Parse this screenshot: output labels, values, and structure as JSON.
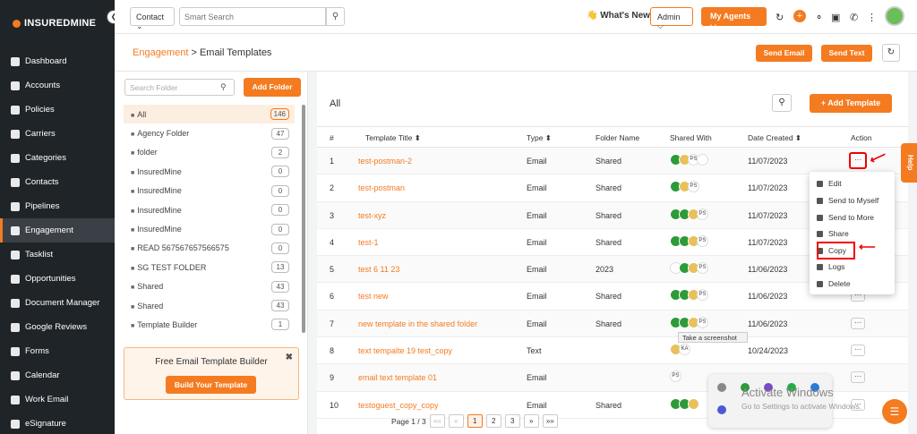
{
  "brand": "INSUREDMINE",
  "sidebar": {
    "items": [
      {
        "label": "Dashboard",
        "icon": "dashboard-icon"
      },
      {
        "label": "Accounts",
        "icon": "accounts-icon"
      },
      {
        "label": "Policies",
        "icon": "policies-icon"
      },
      {
        "label": "Carriers",
        "icon": "carriers-icon"
      },
      {
        "label": "Categories",
        "icon": "categories-icon"
      },
      {
        "label": "Contacts",
        "icon": "contacts-icon"
      },
      {
        "label": "Pipelines",
        "icon": "pipelines-icon"
      },
      {
        "label": "Engagement",
        "icon": "engagement-icon",
        "active": true
      },
      {
        "label": "Tasklist",
        "icon": "tasklist-icon"
      },
      {
        "label": "Opportunities",
        "icon": "opportunities-icon"
      },
      {
        "label": "Document Manager",
        "icon": "document-icon"
      },
      {
        "label": "Google Reviews",
        "icon": "google-icon"
      },
      {
        "label": "Forms",
        "icon": "forms-icon"
      },
      {
        "label": "Calendar",
        "icon": "calendar-icon"
      },
      {
        "label": "Work Email",
        "icon": "mail-icon"
      },
      {
        "label": "eSignature",
        "icon": "signature-icon"
      }
    ]
  },
  "topbar": {
    "select_value": "Contact",
    "search_placeholder": "Smart Search",
    "whats_new": "👋 What's New",
    "admin": "Admin ⌵",
    "my_agents": "My Agents ⌵"
  },
  "subheader": {
    "crumb_parent": "Engagement",
    "crumb_sep": " > ",
    "crumb_current": "Email Templates",
    "send_email": "Send Email",
    "send_text": "Send Text"
  },
  "folders": {
    "search_placeholder": "Search Folder",
    "add_label": "Add Folder",
    "items": [
      {
        "name": "All",
        "count": "146",
        "active": true
      },
      {
        "name": "Agency Folder",
        "count": "47"
      },
      {
        "name": "folder",
        "count": "2"
      },
      {
        "name": "InsuredMine",
        "count": "0"
      },
      {
        "name": "InsuredMine",
        "count": "0"
      },
      {
        "name": "InsuredMine",
        "count": "0"
      },
      {
        "name": "InsuredMine",
        "count": "0"
      },
      {
        "name": "READ 567567657566575",
        "count": "0"
      },
      {
        "name": "SG TEST FOLDER",
        "count": "13"
      },
      {
        "name": "Shared",
        "count": "43"
      },
      {
        "name": "Shared",
        "count": "43"
      },
      {
        "name": "Template Builder",
        "count": "1"
      }
    ],
    "builder_title": "Free Email Template Builder",
    "builder_button": "Build Your Template",
    "builder_close": "✖"
  },
  "main": {
    "heading": "All",
    "add_template": "+ Add Template",
    "columns": [
      "#",
      "Template Title ⬍",
      "Type ⬍",
      "Folder Name",
      "Shared With",
      "Date Created ⬍",
      "Action"
    ],
    "rows": [
      {
        "num": "1",
        "title": "test-postman-2",
        "type": "Email",
        "folder": "Shared",
        "chips": [
          "g",
          "f",
          "PS",
          "t"
        ],
        "date": "11/07/2023"
      },
      {
        "num": "2",
        "title": "test-postman",
        "type": "Email",
        "folder": "Shared",
        "chips": [
          "g",
          "f",
          "PS"
        ],
        "date": "11/07/2023"
      },
      {
        "num": "3",
        "title": "test-xyz",
        "type": "Email",
        "folder": "Shared",
        "chips": [
          "g",
          "g",
          "f",
          "PS"
        ],
        "date": "11/07/2023"
      },
      {
        "num": "4",
        "title": "test-1",
        "type": "Email",
        "folder": "Shared",
        "chips": [
          "g",
          "g",
          "f",
          "PS"
        ],
        "date": "11/07/2023"
      },
      {
        "num": "5",
        "title": "test 6 11 23",
        "type": "Email",
        "folder": "2023",
        "chips": [
          "t",
          "g",
          "f",
          "PS"
        ],
        "date": "11/06/2023"
      },
      {
        "num": "6",
        "title": "test new",
        "type": "Email",
        "folder": "Shared",
        "chips": [
          "g",
          "g",
          "f",
          "PS"
        ],
        "date": "11/06/2023"
      },
      {
        "num": "7",
        "title": "new template in the shared folder",
        "type": "Email",
        "folder": "Shared",
        "chips": [
          "g",
          "g",
          "f",
          "PS"
        ],
        "date": "11/06/2023"
      },
      {
        "num": "8",
        "title": "text tempalte 19 test_copy",
        "type": "Text",
        "folder": "",
        "chips": [
          "f",
          "KA"
        ],
        "date": "10/24/2023"
      },
      {
        "num": "9",
        "title": "email text template 01",
        "type": "Email",
        "folder": "",
        "chips": [
          "PS"
        ],
        "date": ""
      },
      {
        "num": "10",
        "title": "testoguest_copy_copy",
        "type": "Email",
        "folder": "Shared",
        "chips": [
          "g",
          "g",
          "f"
        ],
        "date": ""
      }
    ],
    "action_glyph": "···"
  },
  "pager": {
    "text": "Page 1 / 3",
    "first": "««",
    "prev": "«",
    "p1": "1",
    "p2": "2",
    "p3": "3",
    "next": "»",
    "last": "»»"
  },
  "menu": {
    "items": [
      "Edit",
      "Send to Myself",
      "Send to More",
      "Share",
      "Copy",
      "Logs",
      "Delete"
    ]
  },
  "help": "Help",
  "tooltip": "Take a screenshot",
  "watermark": "Activate Windows",
  "watermark_sub": "Go to Settings to activate Windows.",
  "colors": {
    "accent": "#f47b20",
    "sidebar": "#1f2428",
    "highlight": "#e00000"
  }
}
